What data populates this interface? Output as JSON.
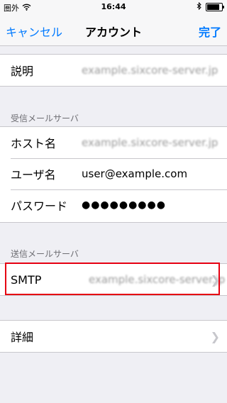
{
  "status": {
    "carrier": "圏外",
    "time": "16:44",
    "battery_level": 0.85
  },
  "nav": {
    "cancel_label": "キャンセル",
    "title": "アカウント",
    "done_label": "完了"
  },
  "account_section": {
    "description_label": "説明",
    "description_value": "example.sixcore-server.jp"
  },
  "incoming_section": {
    "header": "受信メールサーバ",
    "host_label": "ホスト名",
    "host_value": "example.sixcore-server.jp",
    "user_label": "ユーザ名",
    "user_value": "user@example.com",
    "password_label": "パスワード",
    "password_value": "●●●●●●●●●"
  },
  "outgoing_section": {
    "header": "送信メールサーバ",
    "smtp_label": "SMTP",
    "smtp_value": "example.sixcore-server.jp"
  },
  "advanced_section": {
    "details_label": "詳細"
  },
  "colors": {
    "accent": "#007aff",
    "highlight": "#e60012",
    "background": "#efeff4"
  },
  "icons": {
    "wifi": "wifi-icon",
    "bluetooth": "bluetooth-icon",
    "battery": "battery-icon",
    "chevron": "chevron-right-icon"
  }
}
